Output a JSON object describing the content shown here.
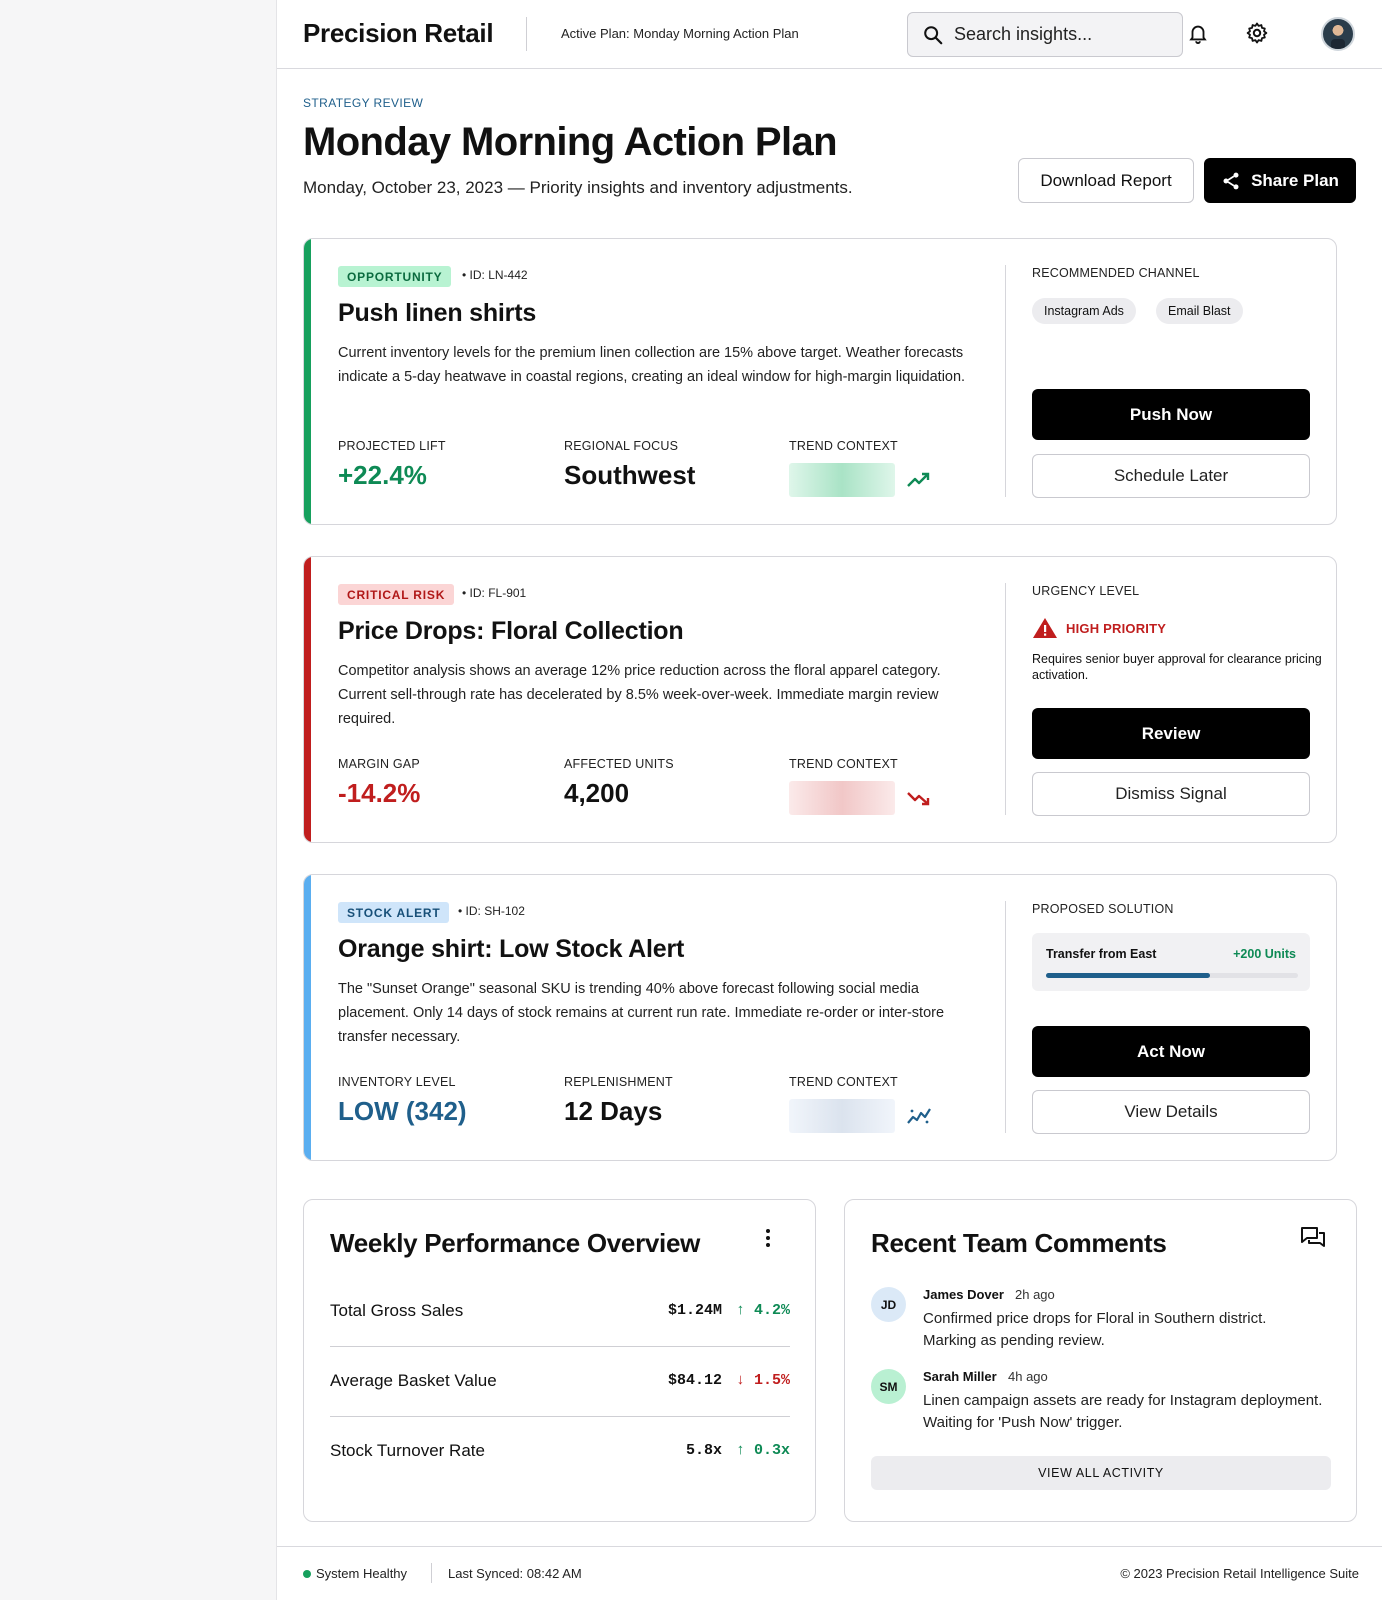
{
  "header": {
    "brand": "Precision Retail",
    "active_plan": "Active Plan: Monday Morning Action Plan",
    "search_placeholder": "Search insights..."
  },
  "page": {
    "eyebrow": "STRATEGY REVIEW",
    "title": "Monday Morning Action Plan",
    "subtitle": "Monday, October 23, 2023 — Priority insights and inventory adjustments.",
    "download_label": "Download Report",
    "share_label": "Share Plan"
  },
  "cards": [
    {
      "badge": "OPPORTUNITY",
      "id": "• ID: LN-442",
      "title": "Push linen shirts",
      "description": "Current inventory levels for the premium linen collection are 15% above target. Weather forecasts indicate a 5-day heatwave in coastal regions, creating an ideal window for high-margin liquidation.",
      "metrics": [
        {
          "label": "PROJECTED LIFT",
          "value": "+22.4%"
        },
        {
          "label": "REGIONAL FOCUS",
          "value": "Southwest"
        },
        {
          "label": "TREND CONTEXT"
        }
      ],
      "side_label": "RECOMMENDED CHANNEL",
      "chips": [
        "Instagram Ads",
        "Email Blast"
      ],
      "primary_action": "Push Now",
      "secondary_action": "Schedule Later",
      "accent_color": "#16a05d"
    },
    {
      "badge": "CRITICAL RISK",
      "id": "• ID: FL-901",
      "title": "Price Drops: Floral Collection",
      "description": "Competitor analysis shows an average 12% price reduction across the floral apparel category. Current sell-through rate has decelerated by 8.5% week-over-week. Immediate margin review required.",
      "metrics": [
        {
          "label": "MARGIN GAP",
          "value": "-14.2%"
        },
        {
          "label": "AFFECTED UNITS",
          "value": "4,200"
        },
        {
          "label": "TREND CONTEXT"
        }
      ],
      "side_label": "URGENCY LEVEL",
      "priority": "HIGH PRIORITY",
      "priority_note": "Requires senior buyer approval for clearance pricing activation.",
      "primary_action": "Review",
      "secondary_action": "Dismiss Signal",
      "accent_color": "#c01e1e"
    },
    {
      "badge": "STOCK ALERT",
      "id": "• ID: SH-102",
      "title": "Orange shirt: Low Stock Alert",
      "description": "The \"Sunset Orange\" seasonal SKU is trending 40% above forecast following social media placement. Only 14 days of stock remains at current run rate. Immediate re-order or inter-store transfer necessary.",
      "metrics": [
        {
          "label": "INVENTORY LEVEL",
          "value": "LOW (342)"
        },
        {
          "label": "REPLENISHMENT",
          "value": "12 Days"
        },
        {
          "label": "TREND CONTEXT"
        }
      ],
      "side_label": "PROPOSED SOLUTION",
      "solution": {
        "name": "Transfer from East",
        "units": "+200 Units",
        "progress": 0.65
      },
      "primary_action": "Act Now",
      "secondary_action": "View Details",
      "accent_color": "#5aaef0"
    }
  ],
  "performance": {
    "title": "Weekly Performance Overview",
    "rows": [
      {
        "name": "Total Gross Sales",
        "value": "$1.24M",
        "delta": "↑ 4.2%",
        "direction": "up"
      },
      {
        "name": "Average Basket Value",
        "value": "$84.12",
        "delta": "↓ 1.5%",
        "direction": "down"
      },
      {
        "name": "Stock Turnover Rate",
        "value": "5.8x",
        "delta": "↑ 0.3x",
        "direction": "up"
      }
    ]
  },
  "comments": {
    "title": "Recent Team Comments",
    "items": [
      {
        "initials": "JD",
        "name": "James Dover",
        "time": "2h ago",
        "text": "Confirmed price drops for Floral in Southern district. Marking as pending review.",
        "avatar_color": "#dbe9f7"
      },
      {
        "initials": "SM",
        "name": "Sarah Miller",
        "time": "4h ago",
        "text": "Linen campaign assets are ready for Instagram deployment. Waiting for 'Push Now' trigger.",
        "avatar_color": "#b9f0d2"
      }
    ],
    "view_all": "VIEW ALL ACTIVITY"
  },
  "footer": {
    "status": "System Healthy",
    "last_synced": "Last Synced: 08:42 AM",
    "copyright": "© 2023 Precision Retail Intelligence Suite"
  },
  "colors": {
    "positive": "#0e8a55",
    "negative": "#c01e1e",
    "info": "#1f5f8b"
  }
}
